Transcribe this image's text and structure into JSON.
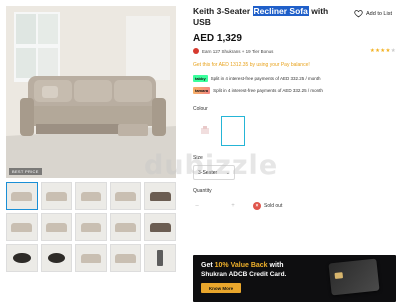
{
  "product": {
    "title_before": "Keith 3-Seater ",
    "title_highlight": "Recliner Sofa",
    "title_after": " with USB",
    "price": "AED 1,329",
    "wishlist_label": "Add to List"
  },
  "rewards": {
    "earn_text": "Earn 127 Shukrans + 19 Tier Bonus",
    "rating_stars": 4,
    "rating_max": 5
  },
  "promo": {
    "text": "Get this for AED 1312.35 by using your  Pay balance!"
  },
  "installments": [
    {
      "provider": "tabby",
      "text": "Split in 4 interest-free payments of AED 332.25 / month"
    },
    {
      "provider": "tamara",
      "text": "Split in 4 interest-free payments of AED 332.25 / month"
    }
  ],
  "gallery": {
    "badge": "BEST PRICE",
    "thumbnails": [
      "light",
      "light",
      "light",
      "light",
      "dark",
      "light",
      "light",
      "light",
      "light",
      "dark",
      "round",
      "round",
      "light",
      "light",
      "tall"
    ]
  },
  "options": {
    "colour_label": "Colour",
    "size_label": "Size",
    "size_value": "3-Seater",
    "quantity_label": "Quantity",
    "qty_minus": "–",
    "qty_value": "",
    "qty_plus": "+",
    "sold_out": "Sold out",
    "sold_out_icon": "x-icon"
  },
  "watermark": "dubizzle",
  "banner": {
    "line1_prefix": "Get ",
    "line1_highlight": "10% Value Back",
    "line1_suffix": " with",
    "line2": "Shukran ADCB Credit Card.",
    "button": "Know More"
  },
  "colors": {
    "accent_gold": "#e9a62c",
    "highlight_blue": "#1f5fc9",
    "star": "#f2b01e"
  }
}
